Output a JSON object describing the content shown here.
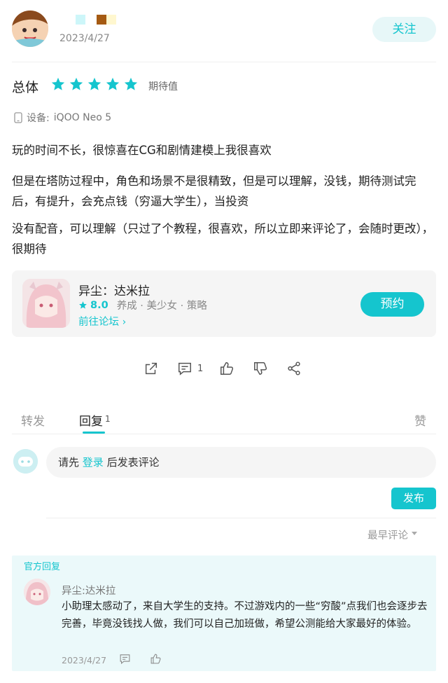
{
  "post": {
    "date": "2023/4/27",
    "follow_label": "关注",
    "overall_label": "总体",
    "stars": 5,
    "rating_text": "期待值",
    "device_label": "设备:",
    "device_name": "iQOO Neo 5",
    "paragraphs": [
      "玩的时间不长，很惊喜在CG和剧情建模上我很喜欢",
      "但是在塔防过程中，角色和场景不是很精致，但是可以理解，没钱，期待测试完后，有提升，会充点钱（穷逼大学生），当投资",
      "没有配音，可以理解（只过了个教程，很喜欢，所以立即来评论了，会随时更改），很期待"
    ]
  },
  "game": {
    "title": "异尘：达米拉",
    "score": "8.0",
    "tags": "养成 · 美少女 · 策略",
    "forum_link": "前往论坛",
    "reserve_label": "预约"
  },
  "actions": {
    "comment_count": "1"
  },
  "tabs": {
    "forward": "转发",
    "reply": "回复",
    "reply_count": "1",
    "like": "赞"
  },
  "comment_input": {
    "prefix": "请先",
    "login": "登录",
    "suffix": "后发表评论",
    "publish_label": "发布"
  },
  "sort": {
    "label": "最早评论"
  },
  "official_reply": {
    "label": "官方回复",
    "author": "异尘:达米拉",
    "text": "小助理太感动了，来自大学生的支持。不过游戏内的一些“穷酸”点我们也会逐步去完善，毕竟没钱找人做，我们可以自己加班做，希望公测能给大家最好的体验。",
    "date": "2023/4/27"
  },
  "colors": {
    "accent": "#15c5ce",
    "accent_light": "#e7f7f8",
    "official_bg": "#ebf9fa",
    "card_bg": "#f5f5f5"
  }
}
